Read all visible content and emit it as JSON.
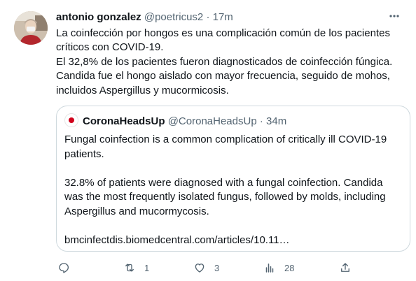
{
  "tweet": {
    "author_name": "antonio gonzalez",
    "author_handle": "@poetricus2",
    "separator": "·",
    "time": "17m",
    "text_lines": [
      "La coinfección por hongos es una complicación común de los pacientes",
      "críticos con COVID-19.",
      " El 32,8% de los pacientes fueron diagnosticados de coinfección fúngica.",
      "Candida fue el hongo aislado con mayor frecuencia, seguido de mohos,",
      "incluidos Aspergillus y mucormicosis."
    ]
  },
  "quote": {
    "author_name": "CoronaHeadsUp",
    "author_handle": "@CoronaHeadsUp",
    "separator": "·",
    "time": "34m",
    "text_lines": [
      "Fungal coinfection is a common complication of critically ill COVID-19",
      "patients.",
      "",
      "32.8% of patients were diagnosed with a fungal  coinfection. Candida",
      "was the most frequently isolated fungus, followed by molds, including",
      "Aspergillus and mucormycosis.",
      "",
      "bmcinfectdis.biomedcentral.com/articles/10.11…"
    ]
  },
  "actions": {
    "reply_icon": "reply-icon",
    "retweet_icon": "retweet-icon",
    "retweet_count": "1",
    "like_icon": "heart-icon",
    "like_count": "3",
    "analytics_icon": "analytics-icon",
    "analytics_count": "28",
    "share_icon": "share-icon"
  },
  "colors": {
    "text": "#0f1419",
    "muted": "#536471",
    "border": "#cfd9de",
    "quote_avatar_red": "#d0021b"
  }
}
